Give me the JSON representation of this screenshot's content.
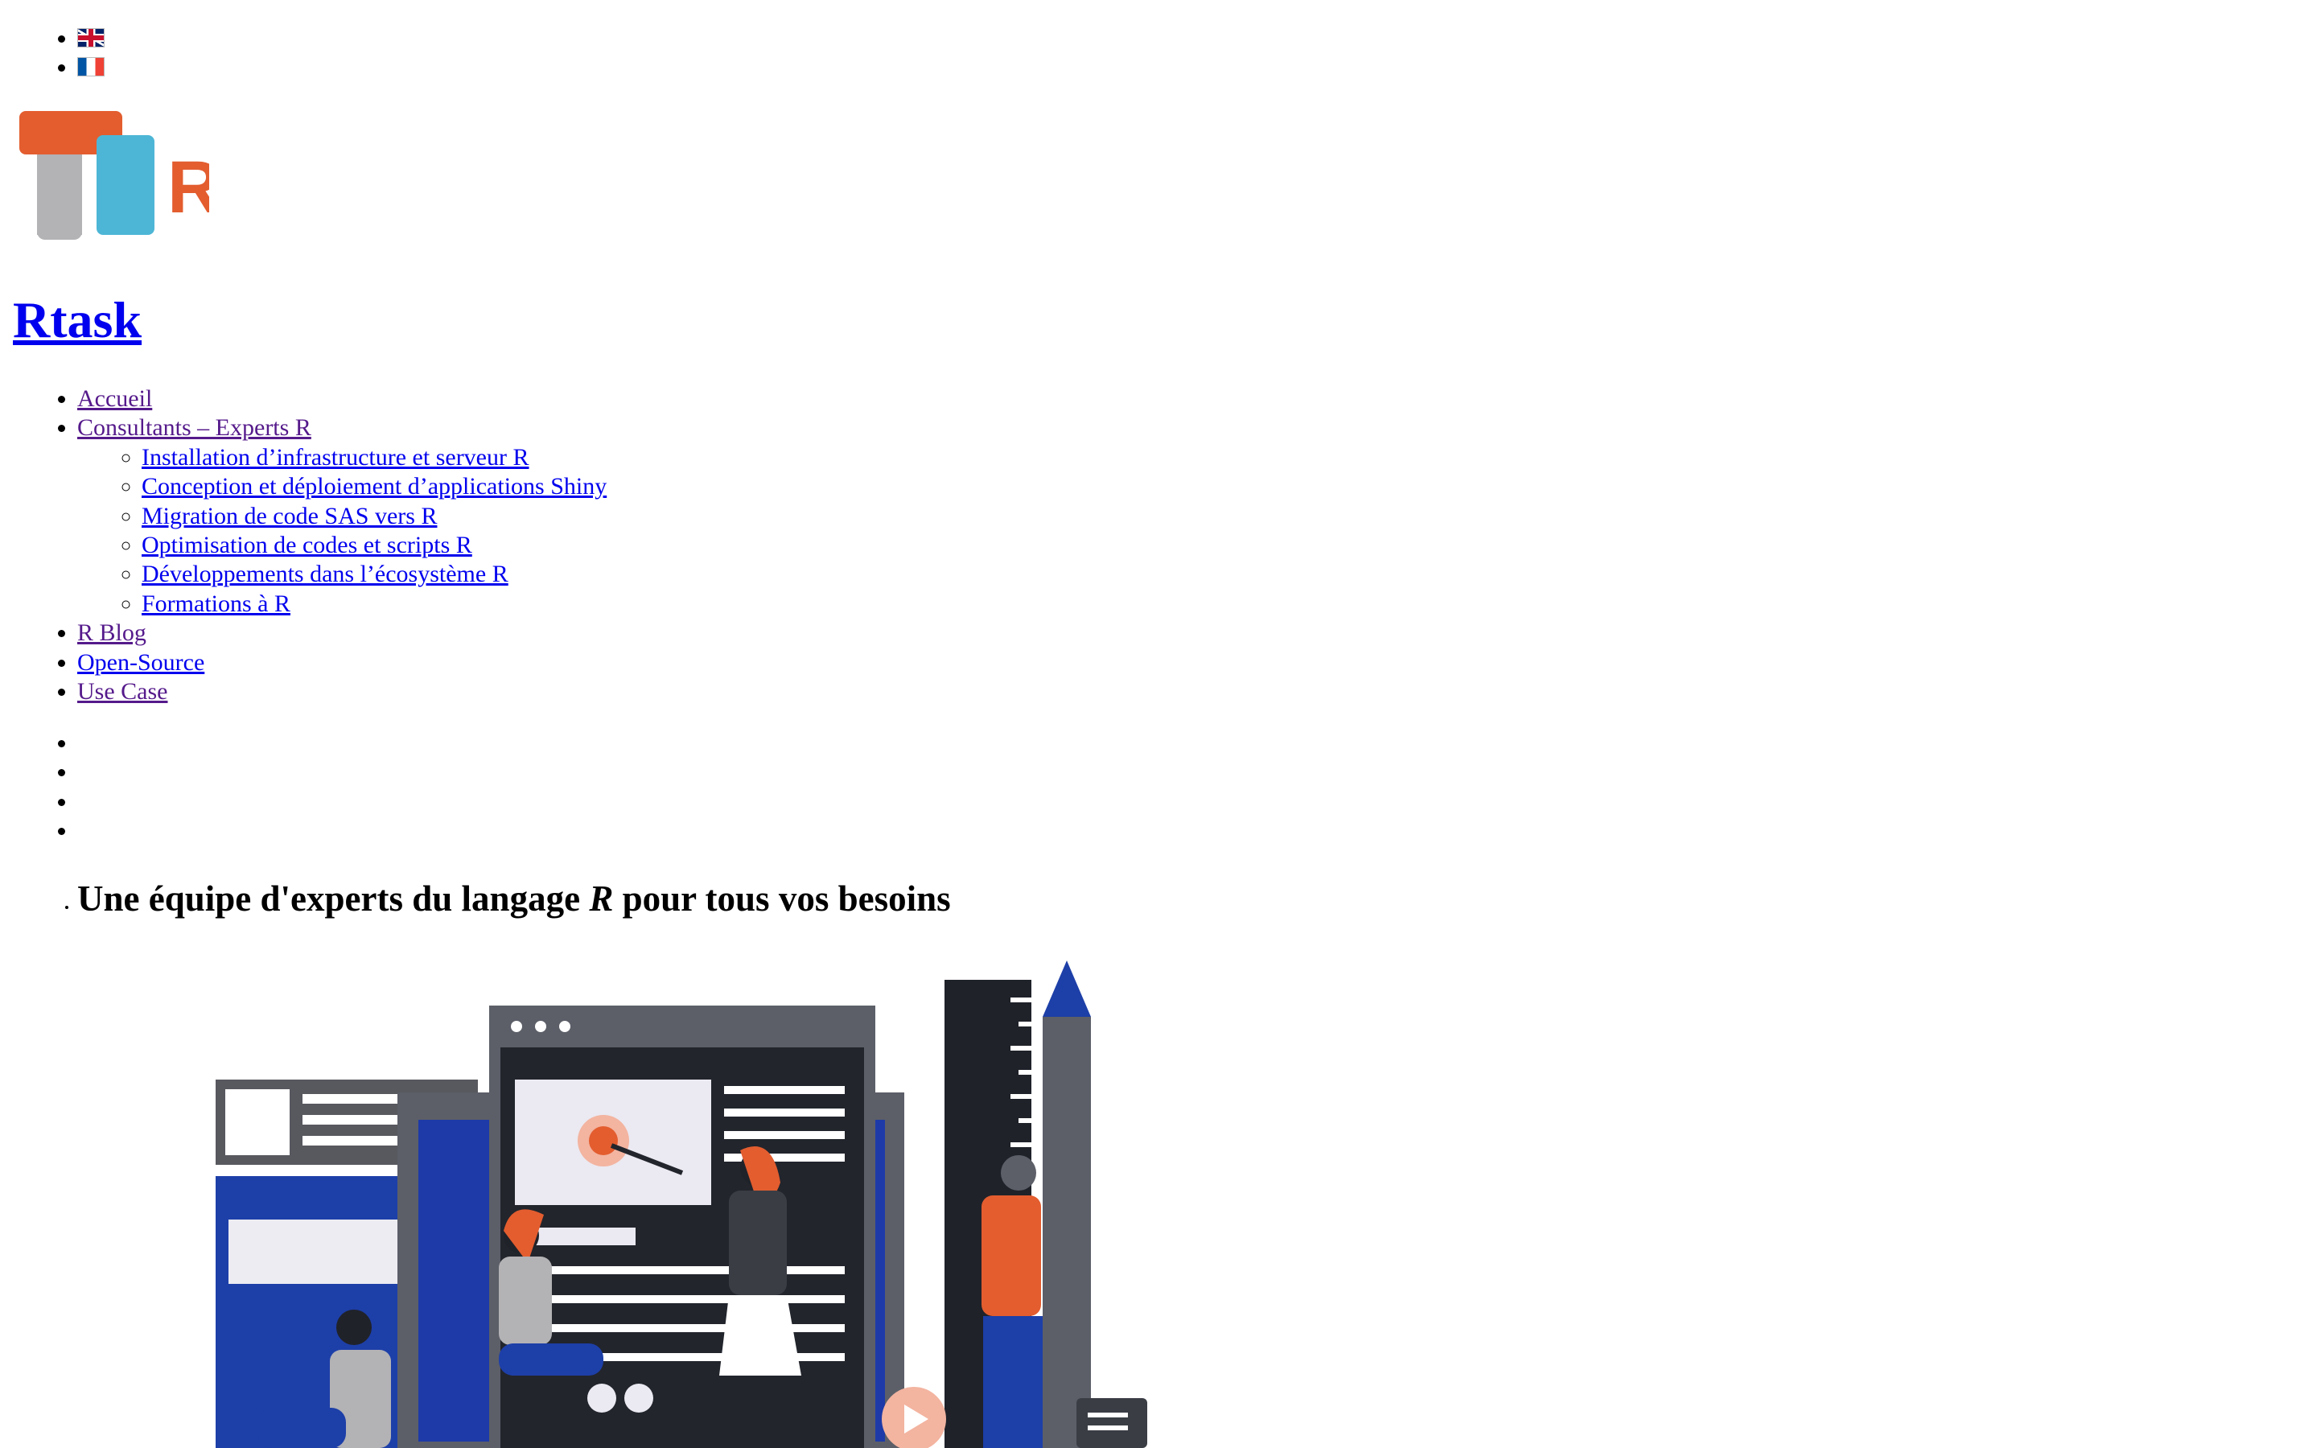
{
  "languages": [
    {
      "code": "en",
      "icon": "uk-flag-icon"
    },
    {
      "code": "fr",
      "icon": "france-flag-icon"
    }
  ],
  "brand": {
    "logo_letter_t": "T",
    "logo_letter_r": "R",
    "title": "Rtask",
    "colors": {
      "orange": "#e35d2f",
      "blue": "#4db6d6",
      "grey": "#b3b2b5"
    }
  },
  "nav": {
    "items": [
      {
        "label": "Accueil"
      },
      {
        "label": "Consultants – Experts R"
      },
      {
        "label": "R Blog"
      },
      {
        "label": "Open-Source"
      },
      {
        "label": "Use Case"
      }
    ],
    "submenu": [
      {
        "label": "Installation d’infrastructure et serveur R"
      },
      {
        "label": "Conception et déploiement d’applications Shiny"
      },
      {
        "label": "Migration de code SAS vers R"
      },
      {
        "label": "Optimisation de codes et scripts R"
      },
      {
        "label": "Développements dans l’écosystème R"
      },
      {
        "label": "Formations à R"
      }
    ]
  },
  "slider": {
    "headline_before": "Une équipe d'experts du langage ",
    "headline_em": "R",
    "headline_after": " pour tous vos besoins"
  },
  "link_colors": {
    "unvisited": "#0000ee",
    "visited": "#551a8b"
  }
}
